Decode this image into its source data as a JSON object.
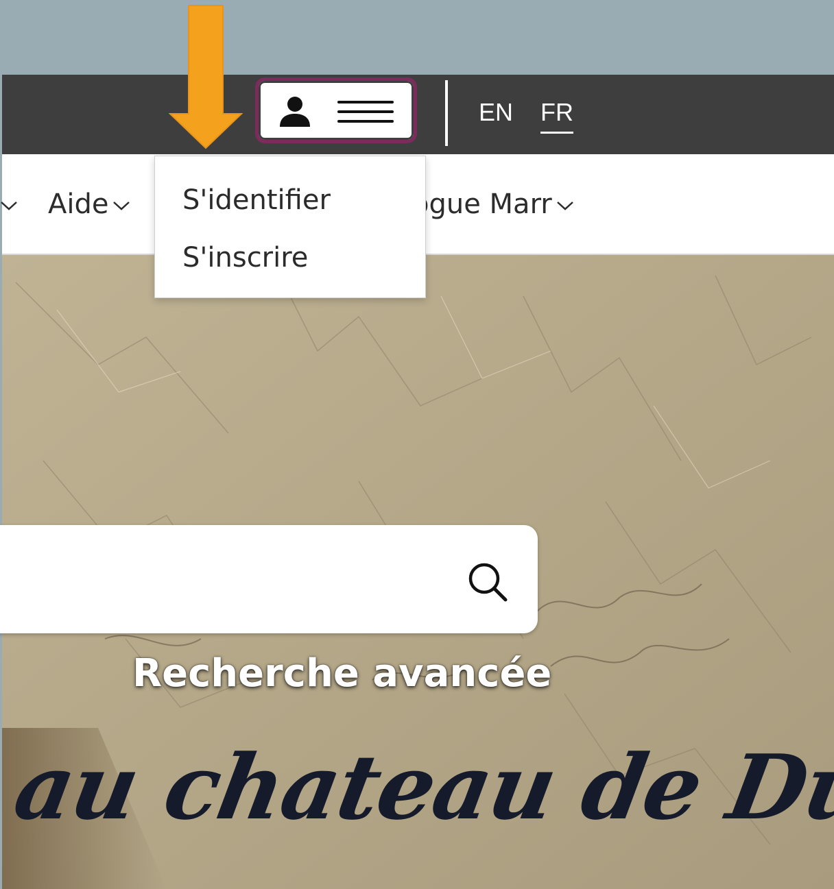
{
  "header": {
    "languages": [
      {
        "code_label": "EN",
        "active": false
      },
      {
        "code_label": "FR",
        "active": true
      }
    ],
    "account_menu": {
      "icons": [
        "person-icon",
        "hamburger-icon"
      ],
      "highlight_color": "#7b2c5d",
      "items": [
        {
          "label": "S'identifier"
        },
        {
          "label": "S'inscrire"
        }
      ]
    }
  },
  "nav": {
    "items": [
      {
        "label": "Aide"
      },
      {
        "label": "ogue Marr"
      }
    ]
  },
  "hero": {
    "search": {
      "value": "",
      "placeholder": ""
    },
    "advanced_search_label": "Recherche avancée",
    "title_fragment": "au chateau de Dux"
  },
  "annotation": {
    "arrow_color": "#f4a21d"
  },
  "colors": {
    "topbar": "#3e3e3e",
    "background": "#9aacb3",
    "title_ink": "#161b2c"
  }
}
